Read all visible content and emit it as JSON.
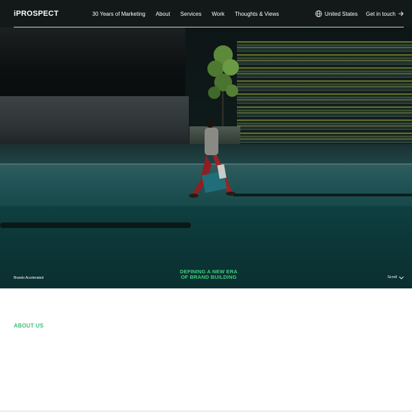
{
  "nav": {
    "logo": "iPROSPECT",
    "links": [
      "30 Years of Marketing",
      "About",
      "Services",
      "Work",
      "Thoughts & Views"
    ],
    "region": "United States",
    "region_icon": "globe-icon",
    "cta": "Get in touch",
    "cta_icon": "arrow-right-icon"
  },
  "hero": {
    "tagline_left": "Brands Accelerated",
    "headline_line1": "DEFINING A NEW ERA",
    "headline_line2": "OF BRAND BUILDING",
    "scroll_label": "Scroll",
    "scroll_icon": "chevron-down-icon"
  },
  "about": {
    "label": "ABOUT US"
  },
  "colors": {
    "accent_green": "#3fd07f",
    "hero_teal": "#0f3a3b"
  }
}
